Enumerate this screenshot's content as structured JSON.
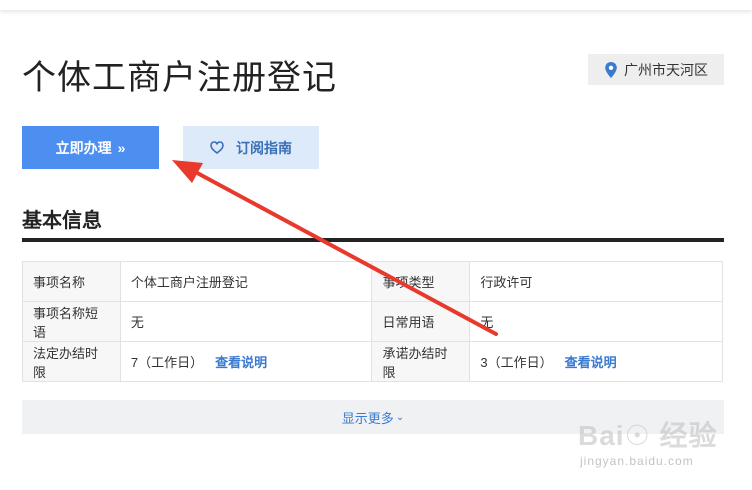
{
  "page": {
    "title": "个体工商户注册登记",
    "location": "广州市天河区"
  },
  "actions": {
    "apply_label": "立即办理",
    "apply_icon": "double-chevron-right",
    "subscribe_label": "订阅指南",
    "subscribe_icon": "heart-outline"
  },
  "section": {
    "title": "基本信息"
  },
  "info_table": {
    "rows": [
      [
        {
          "label": "事项名称",
          "value": "个体工商户注册登记"
        },
        {
          "label": "事项类型",
          "value": "行政许可"
        }
      ],
      [
        {
          "label": "事项名称短语",
          "value": "无"
        },
        {
          "label": "日常用语",
          "value": "无"
        }
      ],
      [
        {
          "label": "法定办结时限",
          "value": "7（工作日）",
          "link": "查看说明"
        },
        {
          "label": "承诺办结时限",
          "value": "3（工作日）",
          "link": "查看说明"
        }
      ]
    ]
  },
  "show_more": {
    "label": "显示更多",
    "icon": "chevron-down"
  },
  "annotation": {
    "color": "#e8392c"
  },
  "watermark": {
    "brand": "Bai☉ 经验",
    "url": "jingyan.baidu.com"
  },
  "colors": {
    "primary": "#4c8ff0",
    "secondary_bg": "#dceafa",
    "link": "#3a7ad0"
  }
}
